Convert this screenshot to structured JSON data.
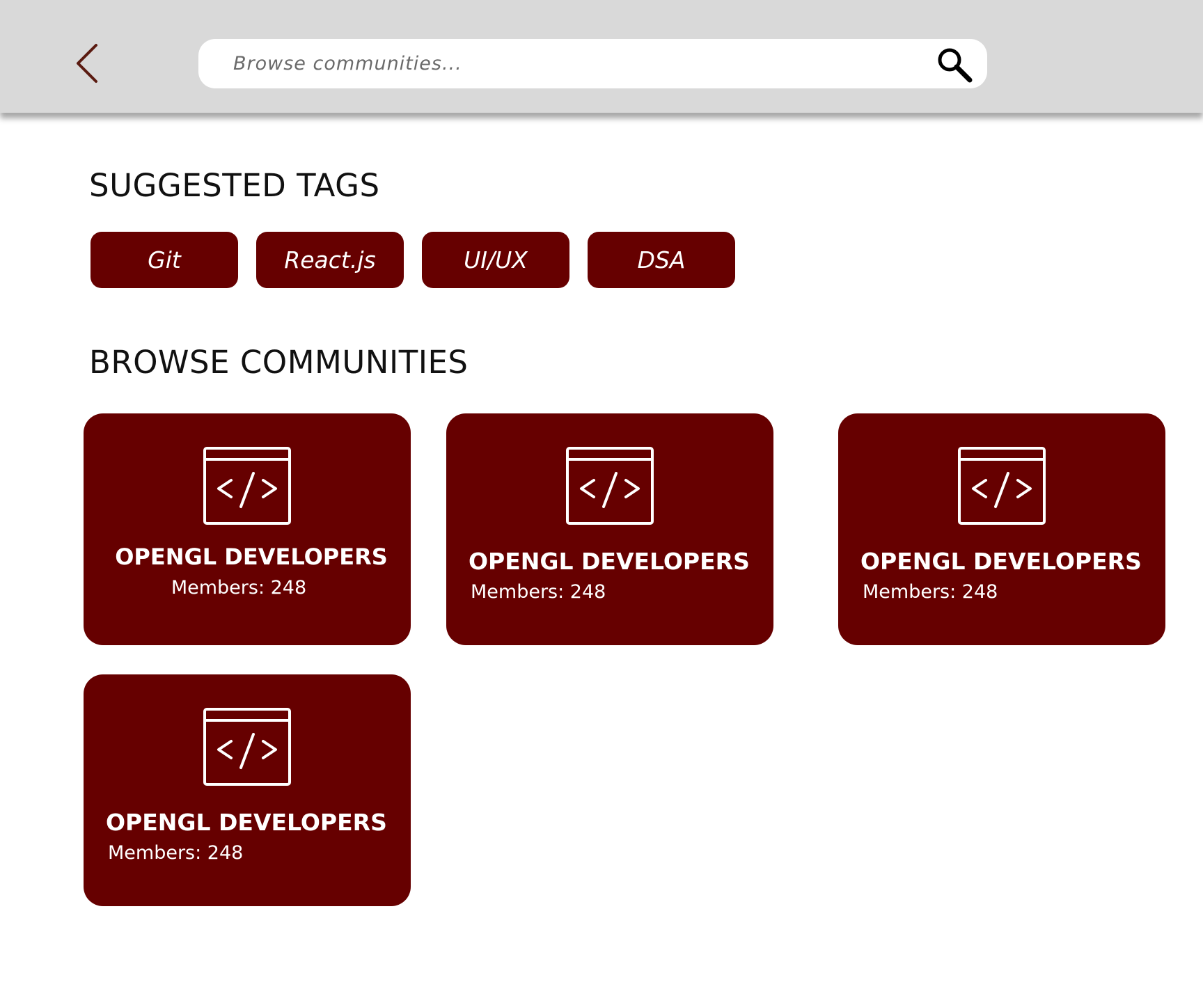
{
  "topbar": {
    "back_icon": "chevron-left-icon",
    "search": {
      "placeholder": "Browse communities...",
      "value": "",
      "icon": "search-icon"
    }
  },
  "suggested_tags": {
    "title": "SUGGESTED TAGS",
    "tags": [
      "Git",
      "React.js",
      "UI/UX",
      "DSA"
    ]
  },
  "browse": {
    "title": "BROWSE COMMUNITIES",
    "cards": [
      {
        "name": "OPENGL DEVELOPERS",
        "members": "Members: 248",
        "icon": "code-window-icon"
      },
      {
        "name": "OPENGL DEVELOPERS",
        "members": "Members: 248",
        "icon": "code-window-icon"
      },
      {
        "name": "OPENGL DEVELOPERS",
        "members": "Members: 248",
        "icon": "code-window-icon"
      },
      {
        "name": "OPENGL DEVELOPERS",
        "members": "Members: 248",
        "icon": "code-window-icon"
      }
    ]
  },
  "colors": {
    "accent": "#660000",
    "topbar": "#d9d9d9",
    "back_icon": "#5a1a10",
    "background": "#ffffff"
  }
}
